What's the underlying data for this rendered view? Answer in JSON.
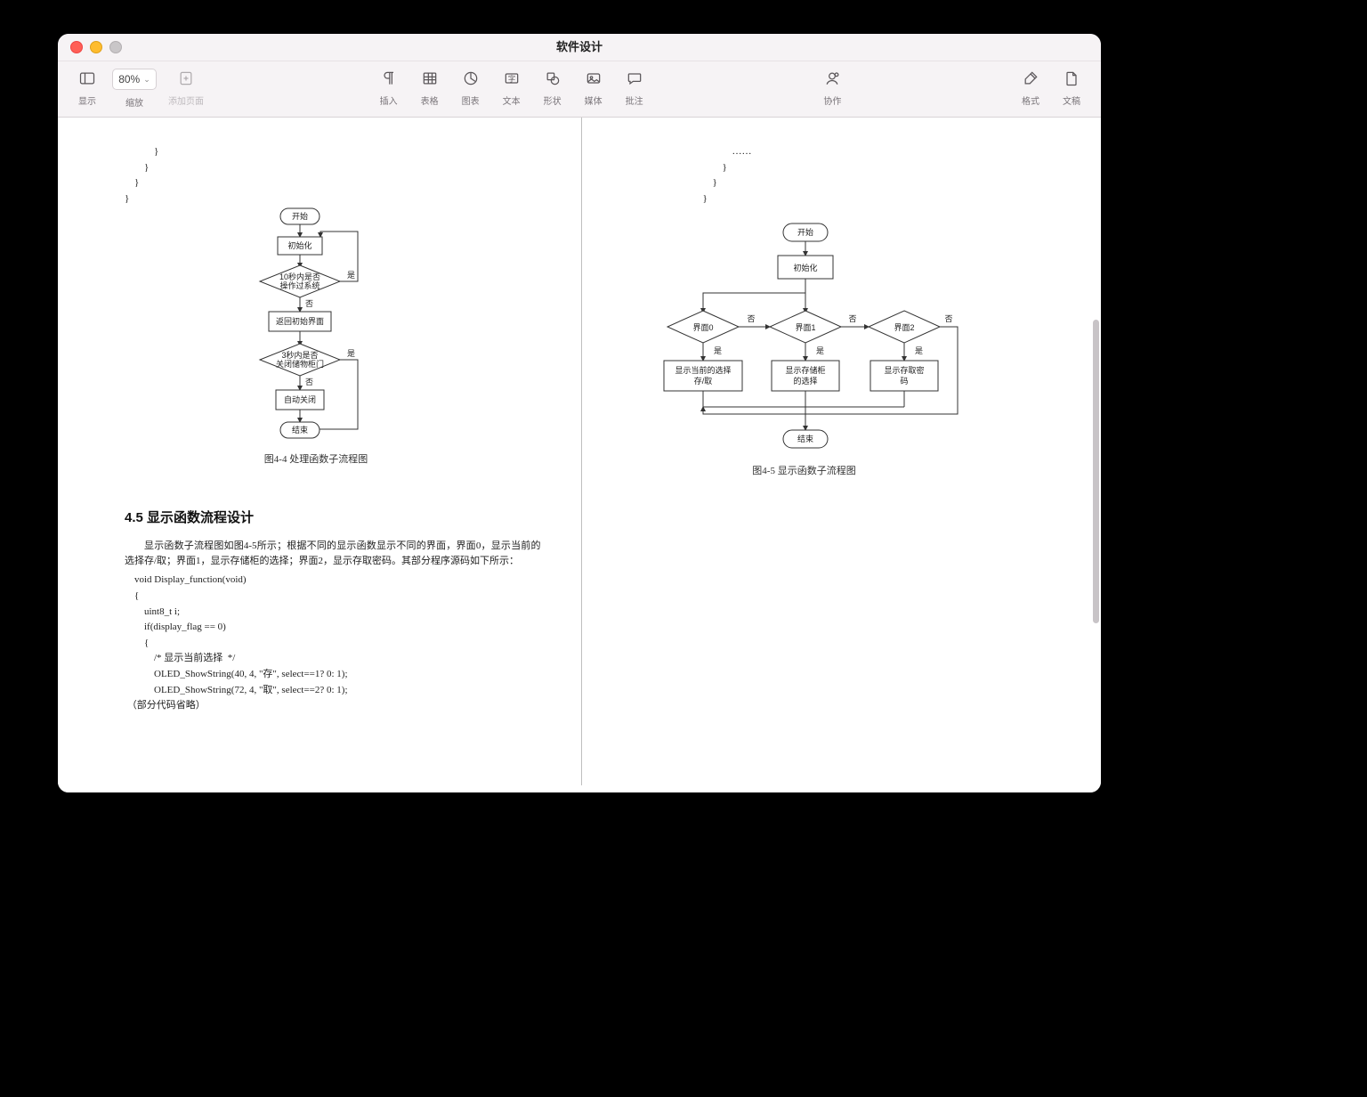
{
  "window": {
    "title": "软件设计"
  },
  "toolbar": {
    "view": {
      "label": "显示"
    },
    "zoom": {
      "label": "缩放",
      "value": "80%"
    },
    "addpage": {
      "label": "添加页面"
    },
    "insert": {
      "label": "插入"
    },
    "table": {
      "label": "表格"
    },
    "chart": {
      "label": "图表"
    },
    "text": {
      "label": "文本"
    },
    "shape": {
      "label": "形状"
    },
    "media": {
      "label": "媒体"
    },
    "comment": {
      "label": "批注"
    },
    "collab": {
      "label": "协作"
    },
    "format": {
      "label": "格式"
    },
    "doc": {
      "label": "文稿"
    }
  },
  "leftPage": {
    "topCode": "            }\n        }\n    }\n}",
    "flow": {
      "start": "开始",
      "init": "初始化",
      "cond1_l1": "10秒内是否",
      "cond1_l2": "操作过系统",
      "yes": "是",
      "no": "否",
      "back": "返回初始界面",
      "cond2_l1": "3秒内是否",
      "cond2_l2": "关闭储物柜门",
      "auto": "自动关闭",
      "end": "结束",
      "caption": "图4-4   处理函数子流程图"
    },
    "sectionTitle": "4.5 显示函数流程设计",
    "para": "显示函数子流程图如图4-5所示；根据不同的显示函数显示不同的界面，界面0，显示当前的选择存/取；界面1，显示存储柜的选择；界面2，显示存取密码。其部分程序源码如下所示：",
    "code2": "    void Display_function(void)\n    {\n        uint8_t i;\n        if(display_flag == 0)\n        {\n            /* 显示当前选择  */\n            OLED_ShowString(40, 4, \"存\", select==1? 0: 1);\n            OLED_ShowString(72, 4, \"取\", select==2? 0: 1);\n （部分代码省略）"
  },
  "rightPage": {
    "topCode": "                ……\n            }\n        }\n    }",
    "flow": {
      "start": "开始",
      "init": "初始化",
      "d0": "界面0",
      "d1": "界面1",
      "d2": "界面2",
      "yes": "是",
      "no": "否",
      "b0_l1": "显示当前的选择",
      "b0_l2": "存/取",
      "b1_l1": "显示存储柜",
      "b1_l2": "的选择",
      "b2_l1": "显示存取密",
      "b2_l2": "码",
      "end": "结束",
      "caption": "图4-5   显示函数子流程图"
    }
  }
}
